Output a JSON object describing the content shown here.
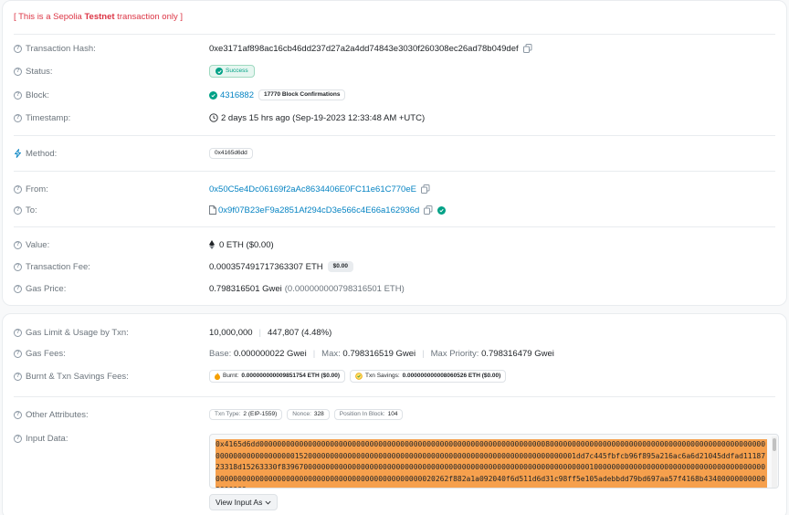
{
  "notice": {
    "prefix": "[ This is a Sepolia ",
    "highlight": "Testnet",
    "suffix": " transaction only ]"
  },
  "labels": {
    "tx_hash": "Transaction Hash:",
    "status": "Status:",
    "block": "Block:",
    "timestamp": "Timestamp:",
    "method": "Method:",
    "from": "From:",
    "to": "To:",
    "value": "Value:",
    "tx_fee": "Transaction Fee:",
    "gas_price": "Gas Price:",
    "gas_limit": "Gas Limit & Usage by Txn:",
    "gas_fees": "Gas Fees:",
    "burnt": "Burnt & Txn Savings Fees:",
    "other": "Other Attributes:",
    "input": "Input Data:"
  },
  "tx": {
    "hash": "0xe3171af898ac16cb46dd237d27a2a4dd74843e3030f260308ec26ad78b049def",
    "status": "Success",
    "block": "4316882",
    "confirmations": "17770 Block Confirmations",
    "timestamp": "2 days 15 hrs ago (Sep-19-2023 12:33:48 AM +UTC)",
    "method": "0x4165d6dd",
    "from": "0x50C5e4Dc06169f2aAc8634406E0FC11e61C770eE",
    "to": "0x9f07B23eF9a2851Af294cD3e566c4E66a162936d",
    "value": "0 ETH ($0.00)",
    "fee": "0.000357491717363307 ETH",
    "fee_usd": "$0.00",
    "gas_price": "0.798316501 Gwei",
    "gas_price_eth": "(0.000000000798316501 ETH)"
  },
  "gas": {
    "limit": "10,000,000",
    "usage": "447,807 (4.48%)",
    "base_label": "Base: ",
    "base": "0.000000022 Gwei",
    "max_label": "Max: ",
    "max": "0.798316519 Gwei",
    "priority_label": "Max Priority: ",
    "priority": "0.798316479 Gwei",
    "burnt_label": "Burnt: ",
    "burnt": "0.000000000009851754 ETH ($0.00)",
    "savings_label": "Txn Savings: ",
    "savings": "0.000000000008060526 ETH ($0.00)"
  },
  "attributes": {
    "txn_type_label": "Txn Type: ",
    "txn_type": "2 (EIP-1559)",
    "nonce_label": "Nonce: ",
    "nonce": "328",
    "position_label": "Position In Block: ",
    "position": "104"
  },
  "input_data": "0x4165d6dd00000000000000000000000000000000000000000000000000000000000000000800000000000000000000000000000000000000000000000000000000000000000001520000000000000000000000000000000000000000000000000000000000001dd7c445fbfcb96f895a216ac6a6d21045ddfad1118723318d15263330f8396700000000000000000000000000000000000000000000000000000000000000000100000000000000000000000000000000000000000000000000000000000000000000000000000000000000020262f882a1a092040f6d511d6d31c98ff5e105adebbdd79bd697aa57f4168b434000000000000000000",
  "view_input_label": "View Input As"
}
